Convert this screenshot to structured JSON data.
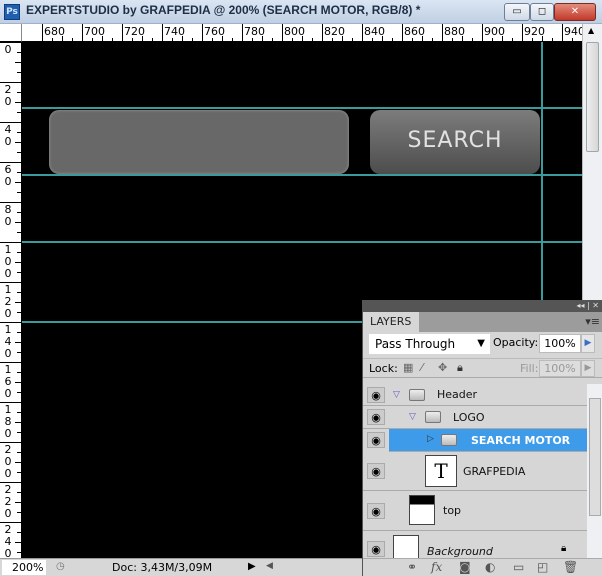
{
  "window": {
    "title": "EXPERTSTUDIO by GRAFPEDIA @ 200% (SEARCH MOTOR, RGB/8) *",
    "app_icon": "Ps",
    "minimize": "▭",
    "maximize": "◻",
    "close": "✕"
  },
  "ruler": {
    "h_labels": [
      "680",
      "700",
      "720",
      "740",
      "760",
      "780",
      "800",
      "820",
      "840",
      "860",
      "880",
      "900",
      "920",
      "940"
    ],
    "v_labels": [
      "0",
      "20",
      "40",
      "60",
      "80",
      "100",
      "120",
      "140",
      "160",
      "180",
      "200",
      "220",
      "240"
    ]
  },
  "canvas": {
    "background": "#000000",
    "guide_color": "#3a9a9c",
    "search_button_label": "SEARCH"
  },
  "status": {
    "zoom": "200%",
    "doc": "Doc: 3,43M/3,09M"
  },
  "layers_panel": {
    "tab": "LAYERS",
    "blend_mode": "Pass Through",
    "opacity_label": "Opacity:",
    "opacity": "100%",
    "lock_label": "Lock:",
    "fill_label": "Fill:",
    "fill": "100%",
    "layers": [
      {
        "name": "Header",
        "type": "group",
        "expanded": true,
        "visible": true
      },
      {
        "name": "LOGO",
        "type": "group",
        "expanded": true,
        "visible": true
      },
      {
        "name": "SEARCH MOTOR",
        "type": "group",
        "expanded": false,
        "visible": true,
        "selected": true
      },
      {
        "name": "GRAFPEDIA",
        "type": "text",
        "visible": true
      },
      {
        "name": "top",
        "type": "pixel",
        "visible": true
      },
      {
        "name": "Background",
        "type": "pixel",
        "visible": true,
        "locked": true
      }
    ],
    "selection_color": "#3d9be9"
  }
}
